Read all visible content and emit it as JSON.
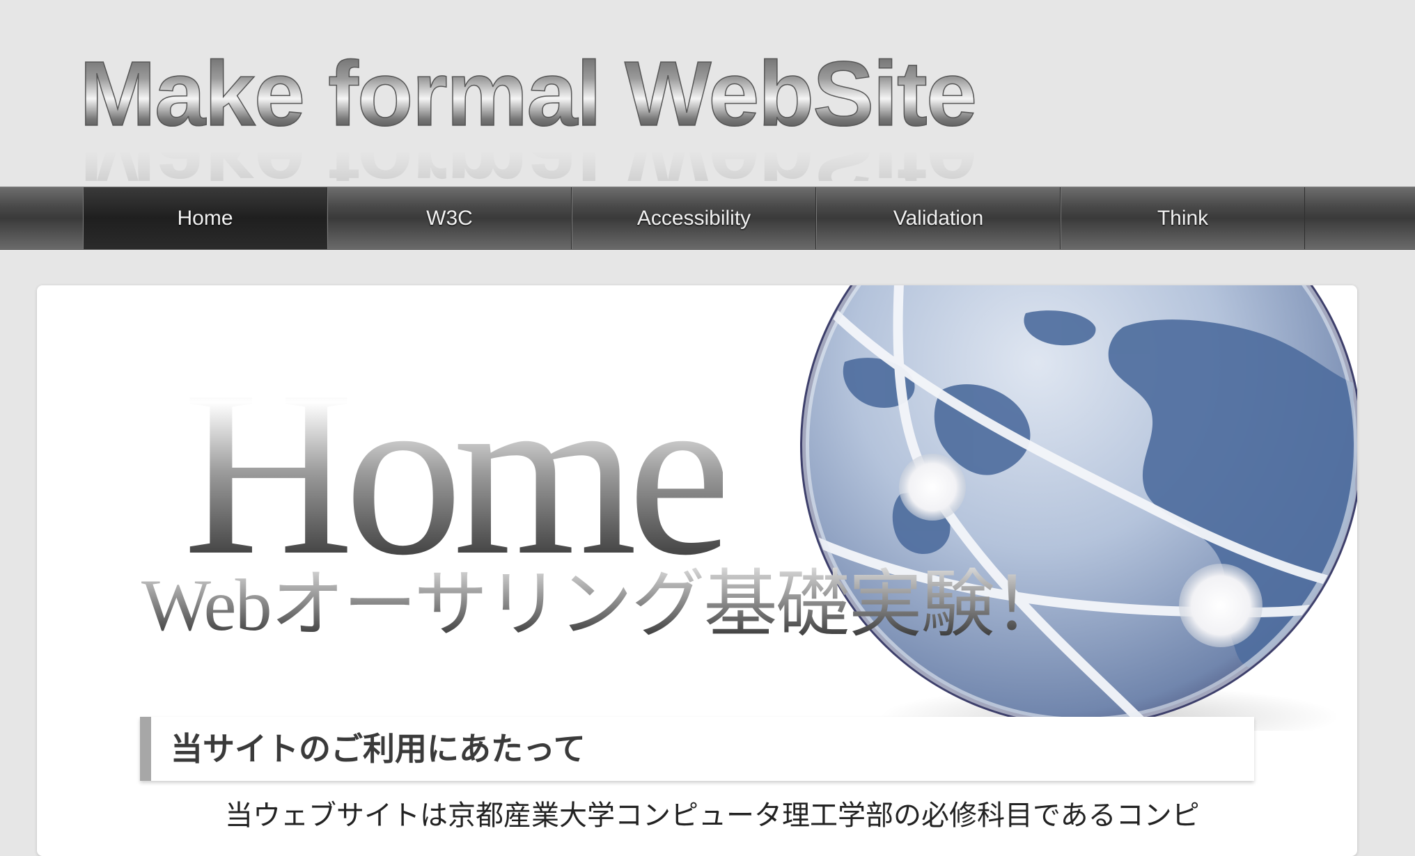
{
  "header": {
    "logo_text": "Make formal WebSite"
  },
  "nav": {
    "items": [
      {
        "label": "Home",
        "active": true
      },
      {
        "label": "W3C",
        "active": false
      },
      {
        "label": "Accessibility",
        "active": false
      },
      {
        "label": "Validation",
        "active": false
      },
      {
        "label": "Think",
        "active": false
      }
    ]
  },
  "hero": {
    "title": "Home",
    "subtitle": "Webオーサリング基礎実験！",
    "image_icon": "globe-network-icon"
  },
  "section": {
    "heading": "当サイトのご利用にあたって",
    "body": "当ウェブサイトは京都産業大学コンピュータ理工学部の必修科目であるコンピ"
  },
  "colors": {
    "page_bg": "#e6e6e6",
    "nav_bg": "#4a4a4a",
    "globe_blue": "#4f6e9e",
    "heading_bar": "#a7a7a7"
  }
}
